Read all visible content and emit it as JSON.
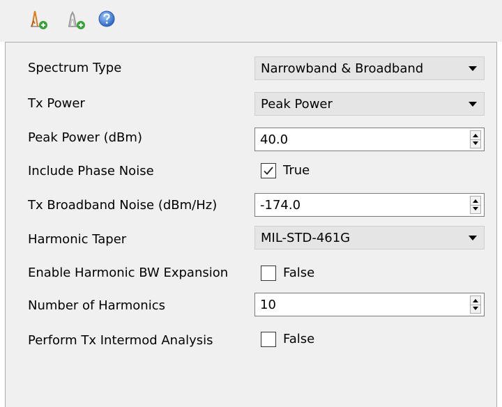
{
  "toolbar": {
    "buttons": [
      {
        "icon": "add-narrowband-spectrum-icon"
      },
      {
        "icon": "add-broadband-spectrum-icon"
      },
      {
        "icon": "help-icon"
      }
    ]
  },
  "properties": {
    "spectrum_type": {
      "label": "Spectrum Type",
      "value": "Narrowband & Broadband"
    },
    "tx_power": {
      "label": "Tx Power",
      "value": "Peak Power"
    },
    "peak_power": {
      "label": "Peak Power (dBm)",
      "value": "40.0"
    },
    "include_phase_noise": {
      "label": "Include Phase Noise",
      "value": "True",
      "checked": true
    },
    "tx_broadband_noise": {
      "label": "Tx Broadband Noise (dBm/Hz)",
      "value": "-174.0"
    },
    "harmonic_taper": {
      "label": "Harmonic Taper",
      "value": "MIL-STD-461G"
    },
    "enable_harmonic_bw_expansion": {
      "label": "Enable Harmonic BW Expansion",
      "value": "False",
      "checked": false
    },
    "number_of_harmonics": {
      "label": "Number of Harmonics",
      "value": "10"
    },
    "perform_tx_intermod_analysis": {
      "label": "Perform Tx Intermod Analysis",
      "value": "False",
      "checked": false
    }
  },
  "colors": {
    "panel_bg": "#f0f0f0",
    "combo_bg": "#e5e5e5",
    "help_blue": "#3a7bd5",
    "icon_green": "#3aa43a",
    "icon_orange": "#e07a1f"
  }
}
